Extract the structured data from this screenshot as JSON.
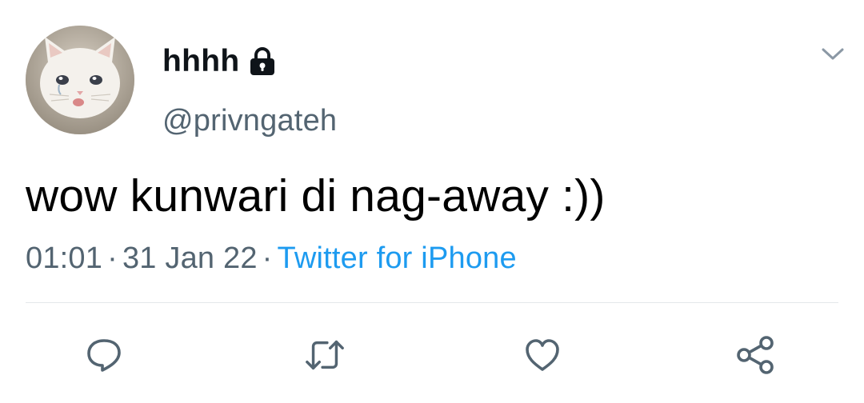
{
  "user": {
    "display_name": "hhhh",
    "handle": "@privngateh",
    "avatar_icon": "crying-cat-avatar",
    "locked_icon": "lock-icon"
  },
  "tweet": {
    "text": "wow kunwari di nag-away :))"
  },
  "meta": {
    "time": "01:01",
    "separator": "·",
    "date": "31 Jan 22",
    "source": "Twitter for iPhone"
  },
  "menu": {
    "icon": "chevron-down-icon"
  },
  "actions": [
    {
      "name": "reply",
      "icon": "reply-icon"
    },
    {
      "name": "retweet",
      "icon": "retweet-icon"
    },
    {
      "name": "like",
      "icon": "heart-icon"
    },
    {
      "name": "share",
      "icon": "share-icon"
    }
  ],
  "colors": {
    "text_primary": "#0f1419",
    "text_secondary": "#536471",
    "link": "#1d9bf0",
    "divider": "#e4e7ea"
  }
}
